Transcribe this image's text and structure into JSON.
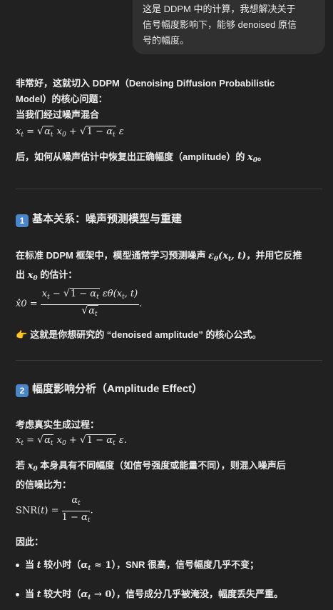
{
  "user_message": {
    "lines": [
      "这是 DDPM 中的计算，我想解决关于",
      "信号幅度影响下，能够 denoised 原信",
      "号的幅度。"
    ]
  },
  "assistant": {
    "intro": {
      "line1": "非常好，这就切入 DDPM（Denoising Diffusion Probabilistic",
      "line2": "Model）的核心问题：",
      "line3": "当我们经过噪声混合",
      "line5_prefix": "后，如何从噪声估计中恢复出正确幅度（amplitude）的 ",
      "line5_suffix": "。"
    },
    "section1": {
      "badge": "1",
      "title": "基本关系：噪声预测模型与重建",
      "para1_prefix": "在标准 DDPM 框架中，模型通常学习预测噪声 ",
      "para1_suffix": "，并用它反推",
      "para2_prefix": "出 ",
      "para2_suffix": " 的估计：",
      "note": "这就是你想研究的 “denoised amplitude” 的核心公式。"
    },
    "section2": {
      "badge": "2",
      "title": "幅度影响分析（Amplitude Effect）",
      "para1": "考虑真实生成过程：",
      "para2_prefix": "若 ",
      "para2_suffix": " 本身具有不同幅度（如信号强度或能量不同），则混入噪声后",
      "para3": "的信噪比为：",
      "therefore": "因此：",
      "bullet1_a": "当 ",
      "bullet1_b": " 较小时（",
      "bullet1_c": "），SNR 很高，信号幅度几乎不变；",
      "bullet2_a": "当 ",
      "bullet2_b": " 较大时（",
      "bullet2_c": "），信号成分几乎被淹没，幅度丢失严重。"
    }
  },
  "colors": {
    "background": "#212121",
    "bubble": "#303030",
    "text": "#ececec",
    "badge": "#4a86c8",
    "divider": "#3a3a3a"
  },
  "icons": [
    "keycap-1-icon",
    "keycap-2-icon",
    "pointing-finger-icon",
    "bullet-icon"
  ]
}
